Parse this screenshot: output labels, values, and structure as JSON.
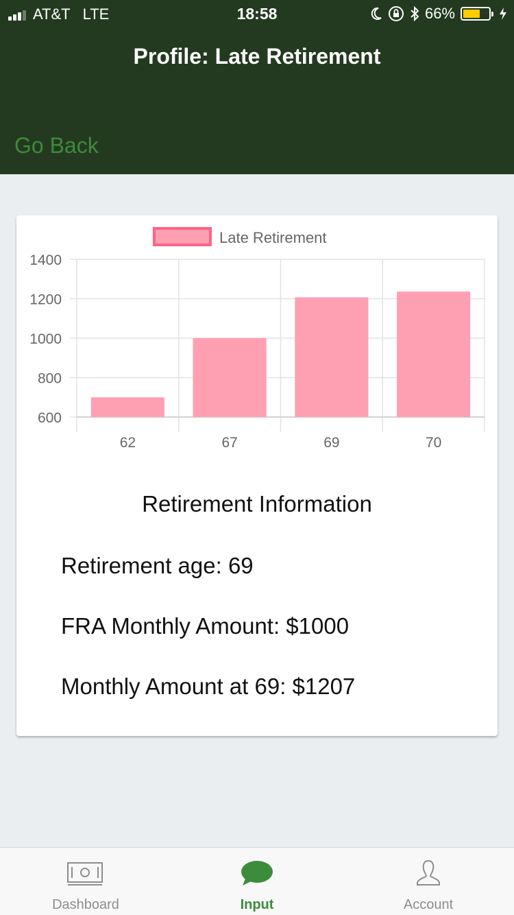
{
  "status_bar": {
    "carrier": "AT&T",
    "network": "LTE",
    "time": "18:58",
    "battery_percent": "66%",
    "battery_level": 0.66,
    "battery_color": "#ffcc00"
  },
  "header": {
    "title": "Profile: Late Retirement",
    "back_label": "Go Back",
    "background": "#233a20",
    "back_color": "#3f8a3a"
  },
  "chart_data": {
    "type": "bar",
    "legend": [
      "Late Retirement"
    ],
    "legend_position": "top",
    "categories": [
      "62",
      "67",
      "69",
      "70"
    ],
    "series": [
      {
        "name": "Late Retirement",
        "values": [
          700,
          1000,
          1207,
          1236
        ],
        "color": "#ff9fb2",
        "border_color": "#ff6384"
      }
    ],
    "ylim": [
      600,
      1400
    ],
    "yticks": [
      "600",
      "800",
      "1000",
      "1200",
      "1400"
    ],
    "grid": true,
    "title": "",
    "xlabel": "",
    "ylabel": ""
  },
  "info": {
    "title": "Retirement Information",
    "retirement_age": "Retirement age: 69",
    "fra_amount": "FRA Monthly Amount: $1000",
    "monthly_amount": "Monthly Amount at 69: $1207"
  },
  "tabs": [
    {
      "label": "Dashboard",
      "icon": "banknote-icon",
      "active": false
    },
    {
      "label": "Input",
      "icon": "chat-bubble-icon",
      "active": true
    },
    {
      "label": "Account",
      "icon": "person-icon",
      "active": false
    }
  ],
  "colors": {
    "active_tab": "#3b8c3b",
    "inactive_tab": "#8d8d8d"
  }
}
